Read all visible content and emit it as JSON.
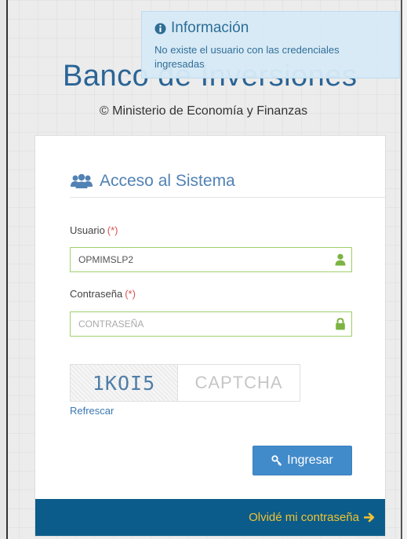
{
  "brand": {
    "title": "Banco de Inversiones",
    "subtitle": "© Ministerio de Economía y Finanzas"
  },
  "notification": {
    "title": "Información",
    "message": "No existe el usuario con las credenciales ingresadas",
    "icon": "info-circle-icon"
  },
  "login": {
    "header": "Acceso al Sistema",
    "header_icon": "users-icon",
    "required_mark": "(*)",
    "username": {
      "label": "Usuario",
      "value": "OPMIMSLP2",
      "icon": "user-icon"
    },
    "password": {
      "label": "Contraseña",
      "value": "",
      "placeholder": "CONTRASEÑA",
      "icon": "lock-icon"
    },
    "captcha": {
      "code": "1KOI5",
      "placeholder": "CAPTCHA",
      "refresh_label": "Refrescar"
    },
    "submit_label": "Ingresar",
    "submit_icon": "key-icon",
    "forgot_label": "Olvidé mi contraseña",
    "forgot_icon": "arrow-right-icon"
  },
  "colors": {
    "brand_blue": "#2a6496",
    "primary_button": "#428bca",
    "footer_bar": "#0b5c8a",
    "footer_link": "#f1c232",
    "valid_border": "#9fd06c",
    "valid_icon": "#7cb342",
    "required_red": "#d9534f",
    "toast_bg": "#d6e9f6"
  }
}
